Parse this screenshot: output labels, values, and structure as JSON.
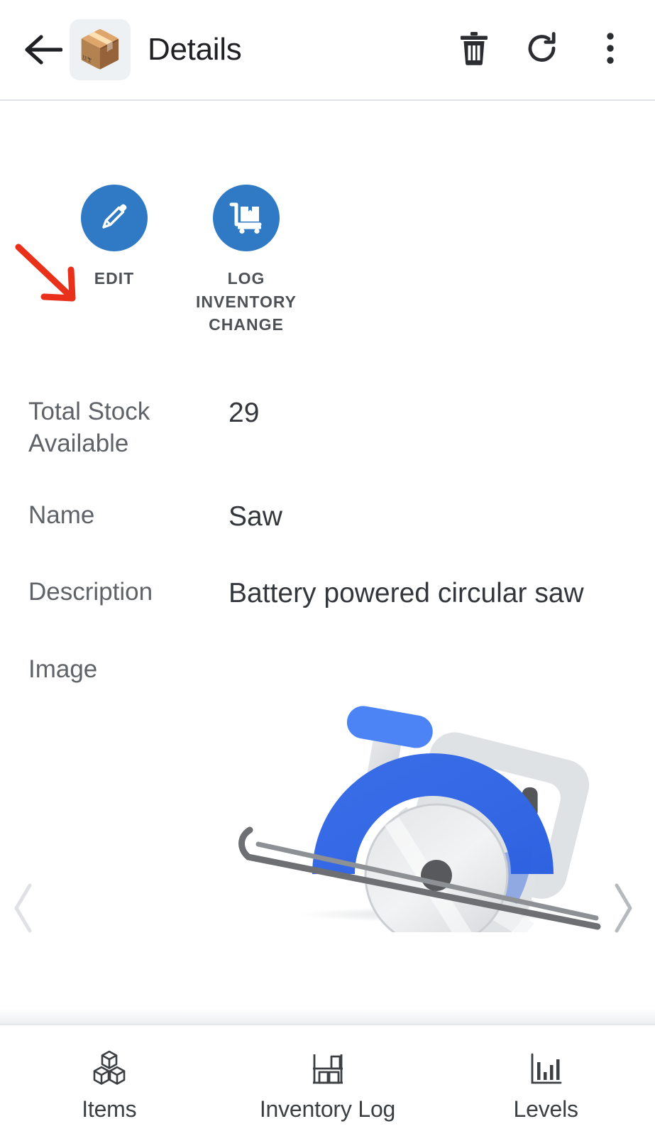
{
  "header": {
    "back_icon": "arrow-left-icon",
    "app_icon": "package-emoji",
    "app_emoji": "📦",
    "title": "Details",
    "actions": [
      {
        "name": "delete",
        "icon": "trash-icon"
      },
      {
        "name": "refresh",
        "icon": "refresh-icon"
      },
      {
        "name": "overflow",
        "icon": "more-vertical-icon"
      }
    ]
  },
  "actions": [
    {
      "label": "Edit",
      "icon": "pencil-icon"
    },
    {
      "label": "Log Inventory Change",
      "icon": "hand-truck-box-icon"
    }
  ],
  "annotation": {
    "type": "arrow",
    "color": "#e8301a",
    "points_to": "edit-button"
  },
  "fields": [
    {
      "label": "Total Stock Available",
      "value": "29"
    },
    {
      "label": "Name",
      "value": "Saw"
    },
    {
      "label": "Description",
      "value": "Battery powered circular saw"
    },
    {
      "label": "Image",
      "value": ""
    }
  ],
  "carousel": {
    "prev_icon": "chevron-left-icon",
    "next_icon": "chevron-right-icon"
  },
  "image": {
    "alt": "circular-saw-illustration"
  },
  "bottom_nav": [
    {
      "label": "Items",
      "icon": "boxes-icon"
    },
    {
      "label": "Inventory Log",
      "icon": "shelf-icon"
    },
    {
      "label": "Levels",
      "icon": "bar-chart-icon"
    }
  ],
  "colors": {
    "accent_blue": "#2f79c5",
    "saw_blue": "#3d6fe8",
    "annotation_red": "#e8301a",
    "label_gray": "#5f6368",
    "value_dark": "#33373b"
  }
}
